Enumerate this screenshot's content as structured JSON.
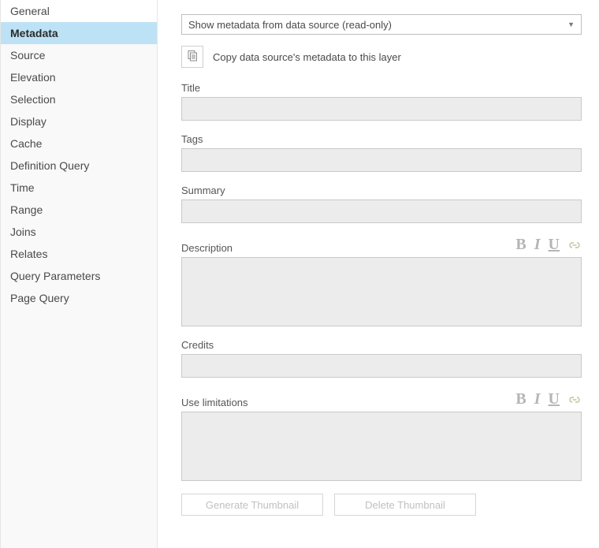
{
  "sidebar": {
    "items": [
      {
        "label": "General"
      },
      {
        "label": "Metadata"
      },
      {
        "label": "Source"
      },
      {
        "label": "Elevation"
      },
      {
        "label": "Selection"
      },
      {
        "label": "Display"
      },
      {
        "label": "Cache"
      },
      {
        "label": "Definition Query"
      },
      {
        "label": "Time"
      },
      {
        "label": "Range"
      },
      {
        "label": "Joins"
      },
      {
        "label": "Relates"
      },
      {
        "label": "Query Parameters"
      },
      {
        "label": "Page Query"
      }
    ],
    "active_index": 1
  },
  "dropdown": {
    "selected": "Show metadata from data source (read-only)"
  },
  "copy_action": {
    "label": "Copy data source's metadata to this layer"
  },
  "fields": {
    "title": {
      "label": "Title",
      "value": ""
    },
    "tags": {
      "label": "Tags",
      "value": ""
    },
    "summary": {
      "label": "Summary",
      "value": ""
    },
    "description": {
      "label": "Description",
      "value": ""
    },
    "credits": {
      "label": "Credits",
      "value": ""
    },
    "use_limitations": {
      "label": "Use limitations",
      "value": ""
    }
  },
  "rich_text_tools": {
    "bold": "B",
    "italic": "I",
    "underline": "U"
  },
  "thumbnail": {
    "generate": "Generate Thumbnail",
    "delete": "Delete Thumbnail"
  }
}
